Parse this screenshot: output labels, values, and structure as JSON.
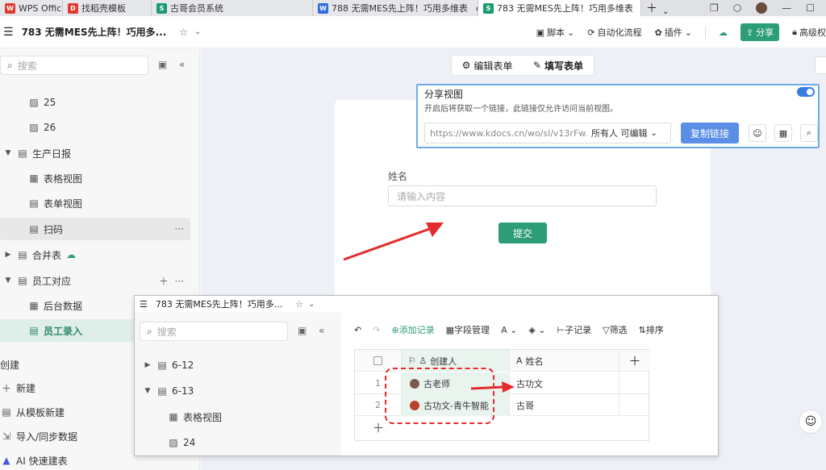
{
  "tabs": [
    {
      "label": "WPS Offic",
      "icon": "W"
    },
    {
      "label": "找稻壳模板",
      "icon": "D"
    },
    {
      "label": "古哥会员系统",
      "icon": "S"
    },
    {
      "label": "788 无需MES先上阵！巧用多维表",
      "icon": "W"
    },
    {
      "label": "783 无需MES先上阵！巧用多维表",
      "icon": "S"
    }
  ],
  "topbar": {
    "title": "783 无需MES先上阵！巧用多...",
    "script": "脚本",
    "automation": "自动化流程",
    "plugin": "插件",
    "share": "分享",
    "advanced": "高级权"
  },
  "sidebar": {
    "search_placeholder": "搜索",
    "items": [
      {
        "label": "25"
      },
      {
        "label": "26"
      },
      {
        "label": "生产日报"
      },
      {
        "label": "表格视图"
      },
      {
        "label": "表单视图"
      },
      {
        "label": "扫码"
      },
      {
        "label": "合并表"
      },
      {
        "label": "员工对应"
      },
      {
        "label": "后台数据"
      },
      {
        "label": "员工录入"
      }
    ],
    "create_label": "创建",
    "actions": [
      "新建",
      "从模板新建",
      "导入/同步数据",
      "AI 快速建表"
    ]
  },
  "modetabs": {
    "edit": "编辑表单",
    "fill": "填写表单"
  },
  "form": {
    "label": "姓名",
    "placeholder": "请输入内容",
    "submit": "提交"
  },
  "sharepopup": {
    "title": "分享视图",
    "desc": "开启后将获取一个链接，此链接仅允许访问当前视图。",
    "url": "https://www.kdocs.cn/wo/sl/v13rFw...",
    "perm": "所有人 可编辑",
    "copy": "复制链接"
  },
  "inset": {
    "title": "783 无需MES先上阵！巧用多...",
    "search_placeholder": "搜索",
    "tree": [
      {
        "label": "6-12"
      },
      {
        "label": "6-13"
      },
      {
        "label": "表格视图"
      },
      {
        "label": "24"
      }
    ],
    "toolbar": {
      "add": "添加记录",
      "fields": "字段管理",
      "sub": "子记录",
      "filter": "筛选",
      "sort": "排序"
    },
    "grid": {
      "col_creator": "创建人",
      "col_name": "姓名",
      "rows": [
        {
          "idx": "1",
          "creator": "古老师",
          "name": "古功文"
        },
        {
          "idx": "2",
          "creator": "古功文-青牛智能",
          "name": "古哥"
        }
      ]
    }
  }
}
